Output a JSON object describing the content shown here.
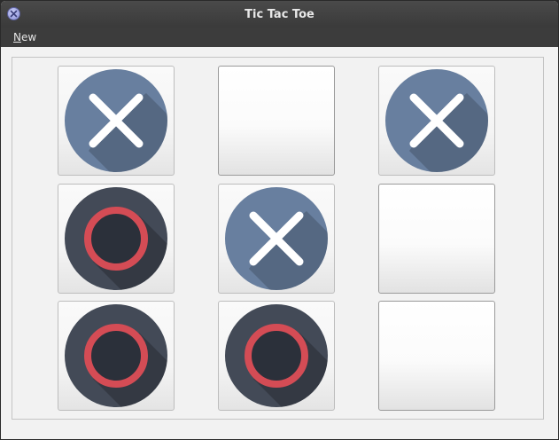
{
  "window": {
    "title": "Tic Tac Toe",
    "close_icon": "close-icon"
  },
  "menu": {
    "items": [
      {
        "label": "New",
        "mnemonic": "N",
        "rest": "ew"
      }
    ]
  },
  "board": {
    "cells": [
      "X",
      "",
      "X",
      "O",
      "X",
      "",
      "O",
      "O",
      ""
    ]
  },
  "colors": {
    "x_disc": "#687f9f",
    "o_disc": "#434a57",
    "o_ring": "#d44c55"
  }
}
